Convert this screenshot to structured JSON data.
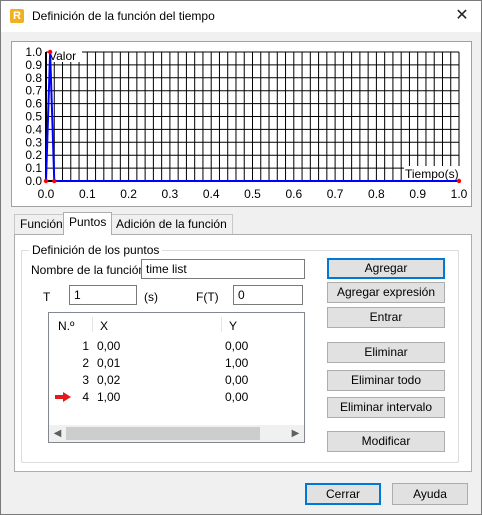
{
  "window": {
    "title": "Definición de la función del tiempo",
    "app_icon_letter": "R",
    "close_glyph": "✕"
  },
  "chart_data": {
    "type": "line",
    "xlabel": "Tiempo(s)",
    "ylabel": "Valor",
    "xlim": [
      0.0,
      1.0
    ],
    "ylim": [
      0.0,
      1.0
    ],
    "x_ticks": [
      "0.0",
      "0.1",
      "0.2",
      "0.3",
      "0.4",
      "0.5",
      "0.6",
      "0.7",
      "0.8",
      "0.9",
      "1.0"
    ],
    "y_ticks": [
      "0.0",
      "0.1",
      "0.2",
      "0.3",
      "0.4",
      "0.5",
      "0.6",
      "0.7",
      "0.8",
      "0.9",
      "1.0"
    ],
    "grid": true,
    "series": [
      {
        "x": [
          0.0,
          0.01,
          0.02,
          1.0
        ],
        "y": [
          0.0,
          1.0,
          0.0,
          0.0
        ],
        "color": "#0000ff"
      }
    ],
    "point_color": "#ff0000"
  },
  "tabs": [
    {
      "label": "Función",
      "active": false
    },
    {
      "label": "Puntos",
      "active": true
    },
    {
      "label": "Adición de la función",
      "active": false
    }
  ],
  "points": {
    "group_title": "Definición de los puntos",
    "name_label": "Nombre de la función",
    "name_value": "time list",
    "t_label": "T",
    "t_value": "1",
    "t_unit": "(s)",
    "ft_label": "F(T)",
    "ft_value": "0",
    "columns": [
      "N.º",
      "X",
      "Y"
    ],
    "rows": [
      {
        "n": "1",
        "x": "0,00",
        "y": "0,00",
        "current": false
      },
      {
        "n": "2",
        "x": "0,01",
        "y": "1,00",
        "current": false
      },
      {
        "n": "3",
        "x": "0,02",
        "y": "0,00",
        "current": false
      },
      {
        "n": "4",
        "x": "1,00",
        "y": "0,00",
        "current": true
      }
    ],
    "buttons": {
      "agregar": "Agregar",
      "agregar_expresion": "Agregar expresión",
      "entrar": "Entrar",
      "eliminar": "Eliminar",
      "eliminar_todo": "Eliminar todo",
      "eliminar_intervalo": "Eliminar intervalo",
      "modificar": "Modificar"
    }
  },
  "footer": {
    "cerrar": "Cerrar",
    "ayuda": "Ayuda"
  },
  "colors": {
    "accent": "#0078d7",
    "arrow": "#e31b1b"
  }
}
